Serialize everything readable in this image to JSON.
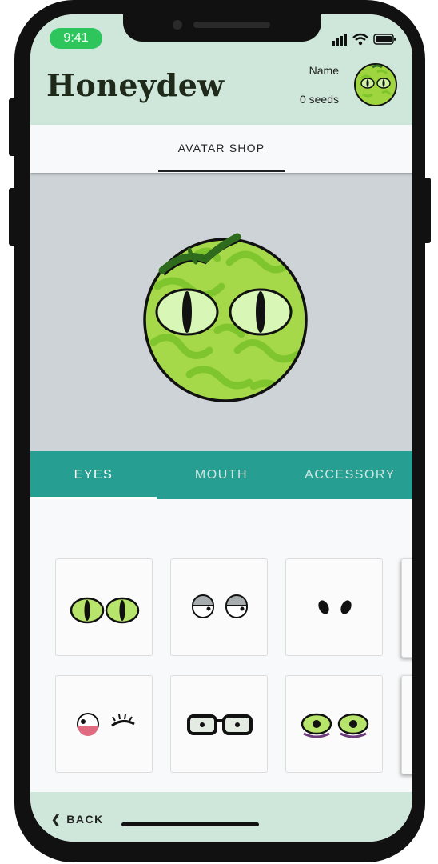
{
  "status_bar": {
    "time": "9:41"
  },
  "header": {
    "title": "Honeydew",
    "user_name": "Name",
    "seeds": "0 seeds"
  },
  "shop_tab": {
    "label": "AVATAR SHOP"
  },
  "category_tabs": [
    {
      "label": "EYES",
      "active": true
    },
    {
      "label": "MOUTH",
      "active": false
    },
    {
      "label": "ACCESSORY",
      "active": false
    }
  ],
  "items": [
    {
      "icon": "green-cat-eyes-icon"
    },
    {
      "icon": "sleepy-gray-eyes-icon"
    },
    {
      "icon": "black-bean-eyes-icon"
    },
    {
      "icon": "wink-eyes-icon"
    },
    {
      "icon": "glasses-eyes-icon"
    },
    {
      "icon": "tired-green-eyes-icon"
    }
  ],
  "footer": {
    "back_label": "BACK"
  },
  "colors": {
    "header_bg": "#cfe7da",
    "tab_bg": "#279e92",
    "preview_bg": "#cdd3d6"
  }
}
